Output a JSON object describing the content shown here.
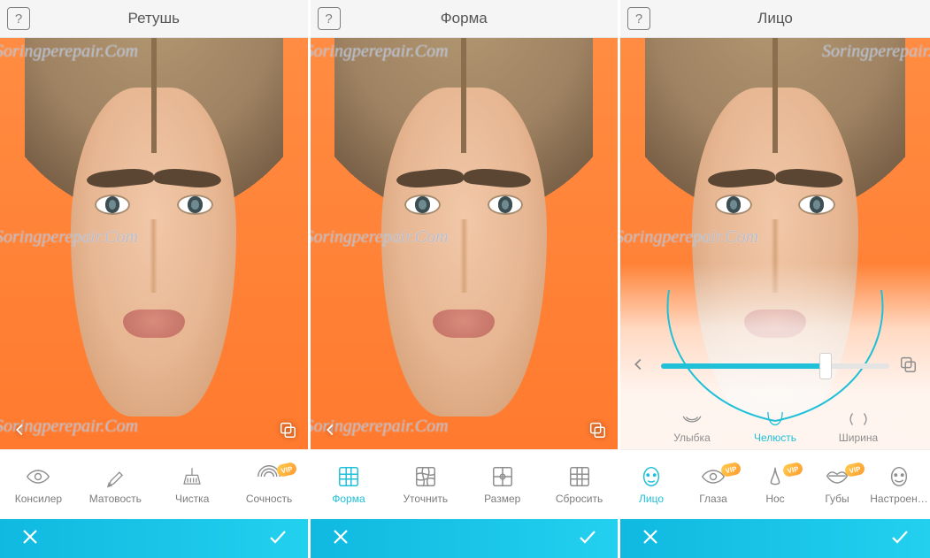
{
  "watermark": "Soringperepair.Com",
  "panels": [
    {
      "title": "Ретушь",
      "tools": [
        {
          "label": "Консилер",
          "icon": "eye",
          "vip": false,
          "active": false
        },
        {
          "label": "Матовость",
          "icon": "brush",
          "vip": false,
          "active": false
        },
        {
          "label": "Чистка",
          "icon": "broom",
          "vip": false,
          "active": false
        },
        {
          "label": "Сочность",
          "icon": "vibrance",
          "vip": true,
          "active": false
        }
      ]
    },
    {
      "title": "Форма",
      "tools": [
        {
          "label": "Форма",
          "icon": "grid",
          "vip": false,
          "active": true
        },
        {
          "label": "Уточнить",
          "icon": "grid-warp",
          "vip": false,
          "active": false
        },
        {
          "label": "Размер",
          "icon": "grid-size",
          "vip": false,
          "active": false
        },
        {
          "label": "Сбросить",
          "icon": "grid-reset",
          "vip": false,
          "active": false
        }
      ]
    },
    {
      "title": "Лицо",
      "slider_value": 72,
      "sub_tools": [
        {
          "label": "Улыбка",
          "icon": "smile",
          "active": false
        },
        {
          "label": "Челюсть",
          "icon": "jaw",
          "active": true
        },
        {
          "label": "Ширина",
          "icon": "width",
          "active": false
        }
      ],
      "tools": [
        {
          "label": "Лицо",
          "icon": "face",
          "vip": false,
          "active": true
        },
        {
          "label": "Глаза",
          "icon": "eye",
          "vip": true,
          "active": false
        },
        {
          "label": "Нос",
          "icon": "nose",
          "vip": true,
          "active": false
        },
        {
          "label": "Губы",
          "icon": "lips",
          "vip": true,
          "active": false
        },
        {
          "label": "Настроен…",
          "icon": "mood",
          "vip": false,
          "active": false
        }
      ]
    }
  ],
  "vip_badge": "VIP"
}
